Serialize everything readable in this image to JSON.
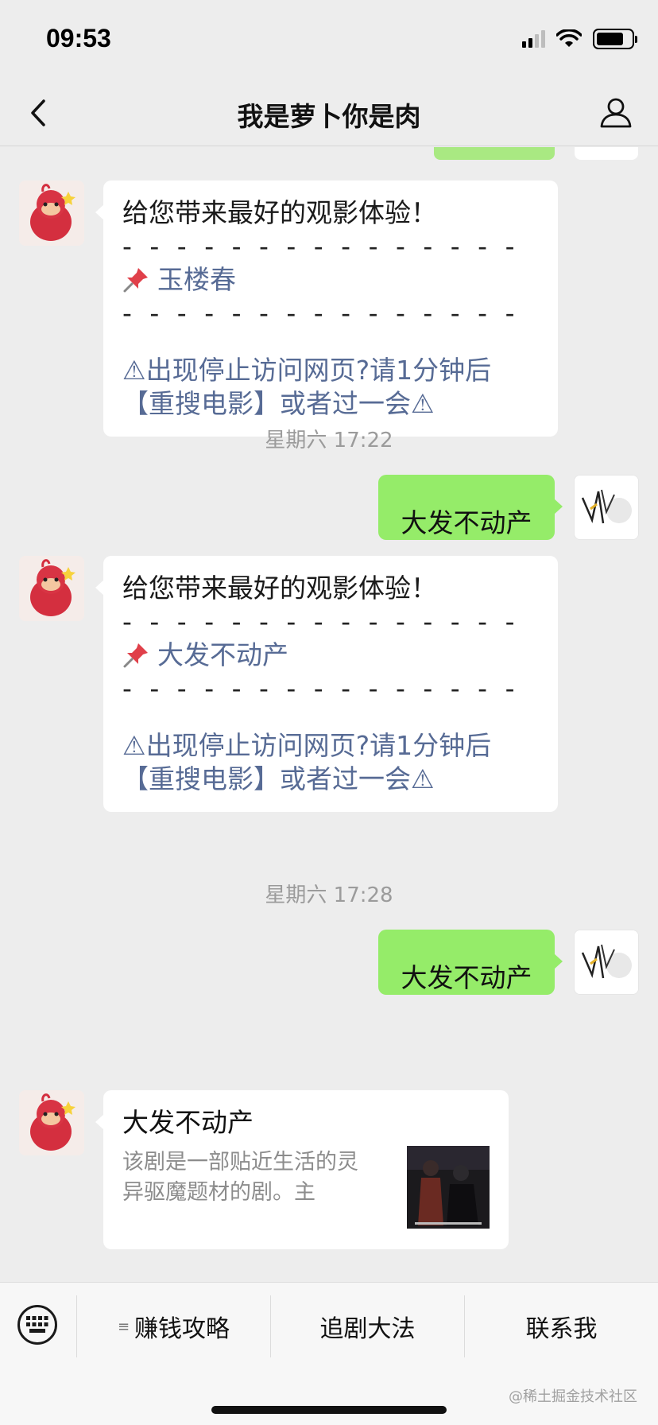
{
  "status": {
    "time": "09:53"
  },
  "nav": {
    "title": "我是萝卜你是肉"
  },
  "messages": [
    {
      "line1": "给您带来最好的观影体验！",
      "dashes": "- - - - - - - - - - - - - - -",
      "title": "玉楼春",
      "dashes2": "- - - - - - - - - - - - - - -",
      "warning": "⚠出现停止访问网页?请1分钟后【重搜电影】或者过一会⚠"
    },
    {
      "timestamp": "星期六 17:22",
      "me_text": "大发不动产"
    },
    {
      "line1": "给您带来最好的观影体验！",
      "dashes": "- - - - - - - - - - - - - - -",
      "title": "大发不动产",
      "dashes2": "- - - - - - - - - - - - - - -",
      "warning": "⚠出现停止访问网页?请1分钟后【重搜电影】或者过一会⚠"
    },
    {
      "timestamp": "星期六 17:28",
      "me_text": "大发不动产"
    },
    {
      "card_title": "大发不动产",
      "card_desc": "该剧是一部贴近生活的灵异驱魔题材的剧。主"
    }
  ],
  "menu": {
    "item1": "赚钱攻略",
    "item1_prefix": "≡",
    "item2": "追剧大法",
    "item3": "联系我"
  },
  "watermark": "@稀土掘金技术社区",
  "colors": {
    "bg": "#ededed",
    "me_bubble": "#95ec69",
    "link": "#576b95"
  }
}
